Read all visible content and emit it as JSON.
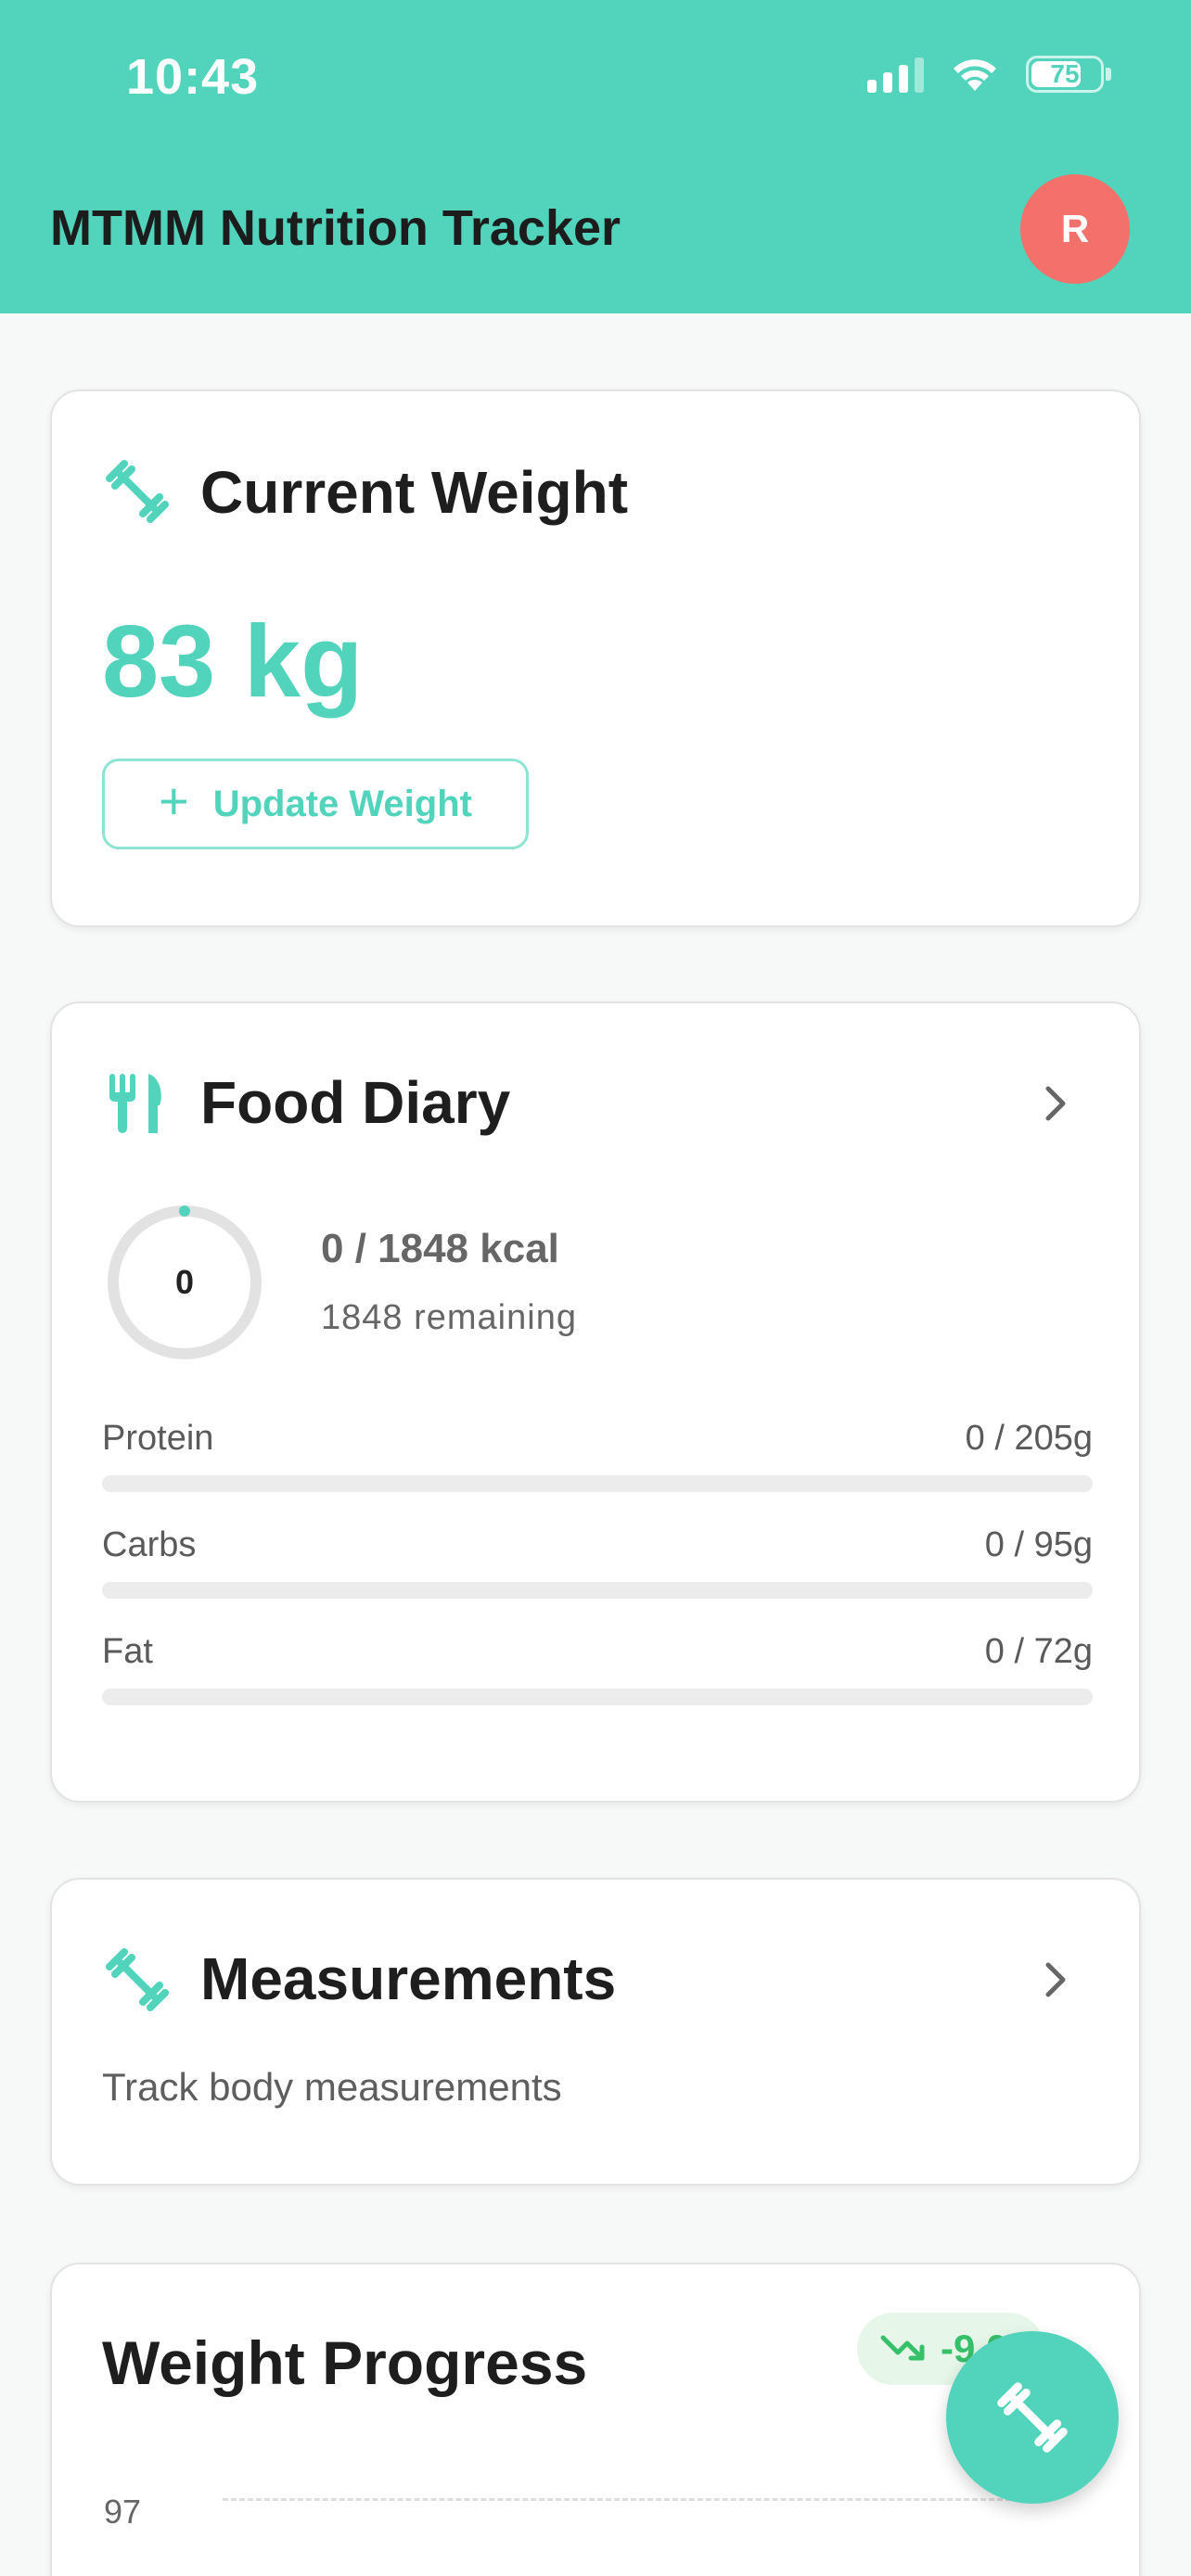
{
  "status": {
    "time": "10:43",
    "battery": "75",
    "battery_fraction": 0.75
  },
  "header": {
    "title": "MTMM Nutrition Tracker",
    "avatar_initial": "R"
  },
  "weight_card": {
    "icon": "dumbbell-icon",
    "title": "Current Weight",
    "value": "83 kg",
    "update_button": "Update Weight"
  },
  "food_diary": {
    "icon": "fork-knife-icon",
    "title": "Food Diary",
    "ring_value": "0",
    "calories_consumed": 0,
    "calories_goal": 1848,
    "kcal_text": "0 / 1848 kcal",
    "remaining_text": "1848 remaining",
    "macros": [
      {
        "name": "Protein",
        "text": "0 / 205g",
        "consumed": 0,
        "goal": 205
      },
      {
        "name": "Carbs",
        "text": "0 / 95g",
        "consumed": 0,
        "goal": 95
      },
      {
        "name": "Fat",
        "text": "0 / 72g",
        "consumed": 0,
        "goal": 72
      }
    ]
  },
  "measurements": {
    "icon": "dumbbell-icon",
    "title": "Measurements",
    "subtitle": "Track body measurements"
  },
  "weight_progress": {
    "title": "Weight Progress",
    "trend_badge": "-9.0",
    "axis_top_label": "97"
  },
  "colors": {
    "accent": "#52d3bc",
    "avatar": "#f4706a",
    "trend_green": "#37c06a"
  }
}
